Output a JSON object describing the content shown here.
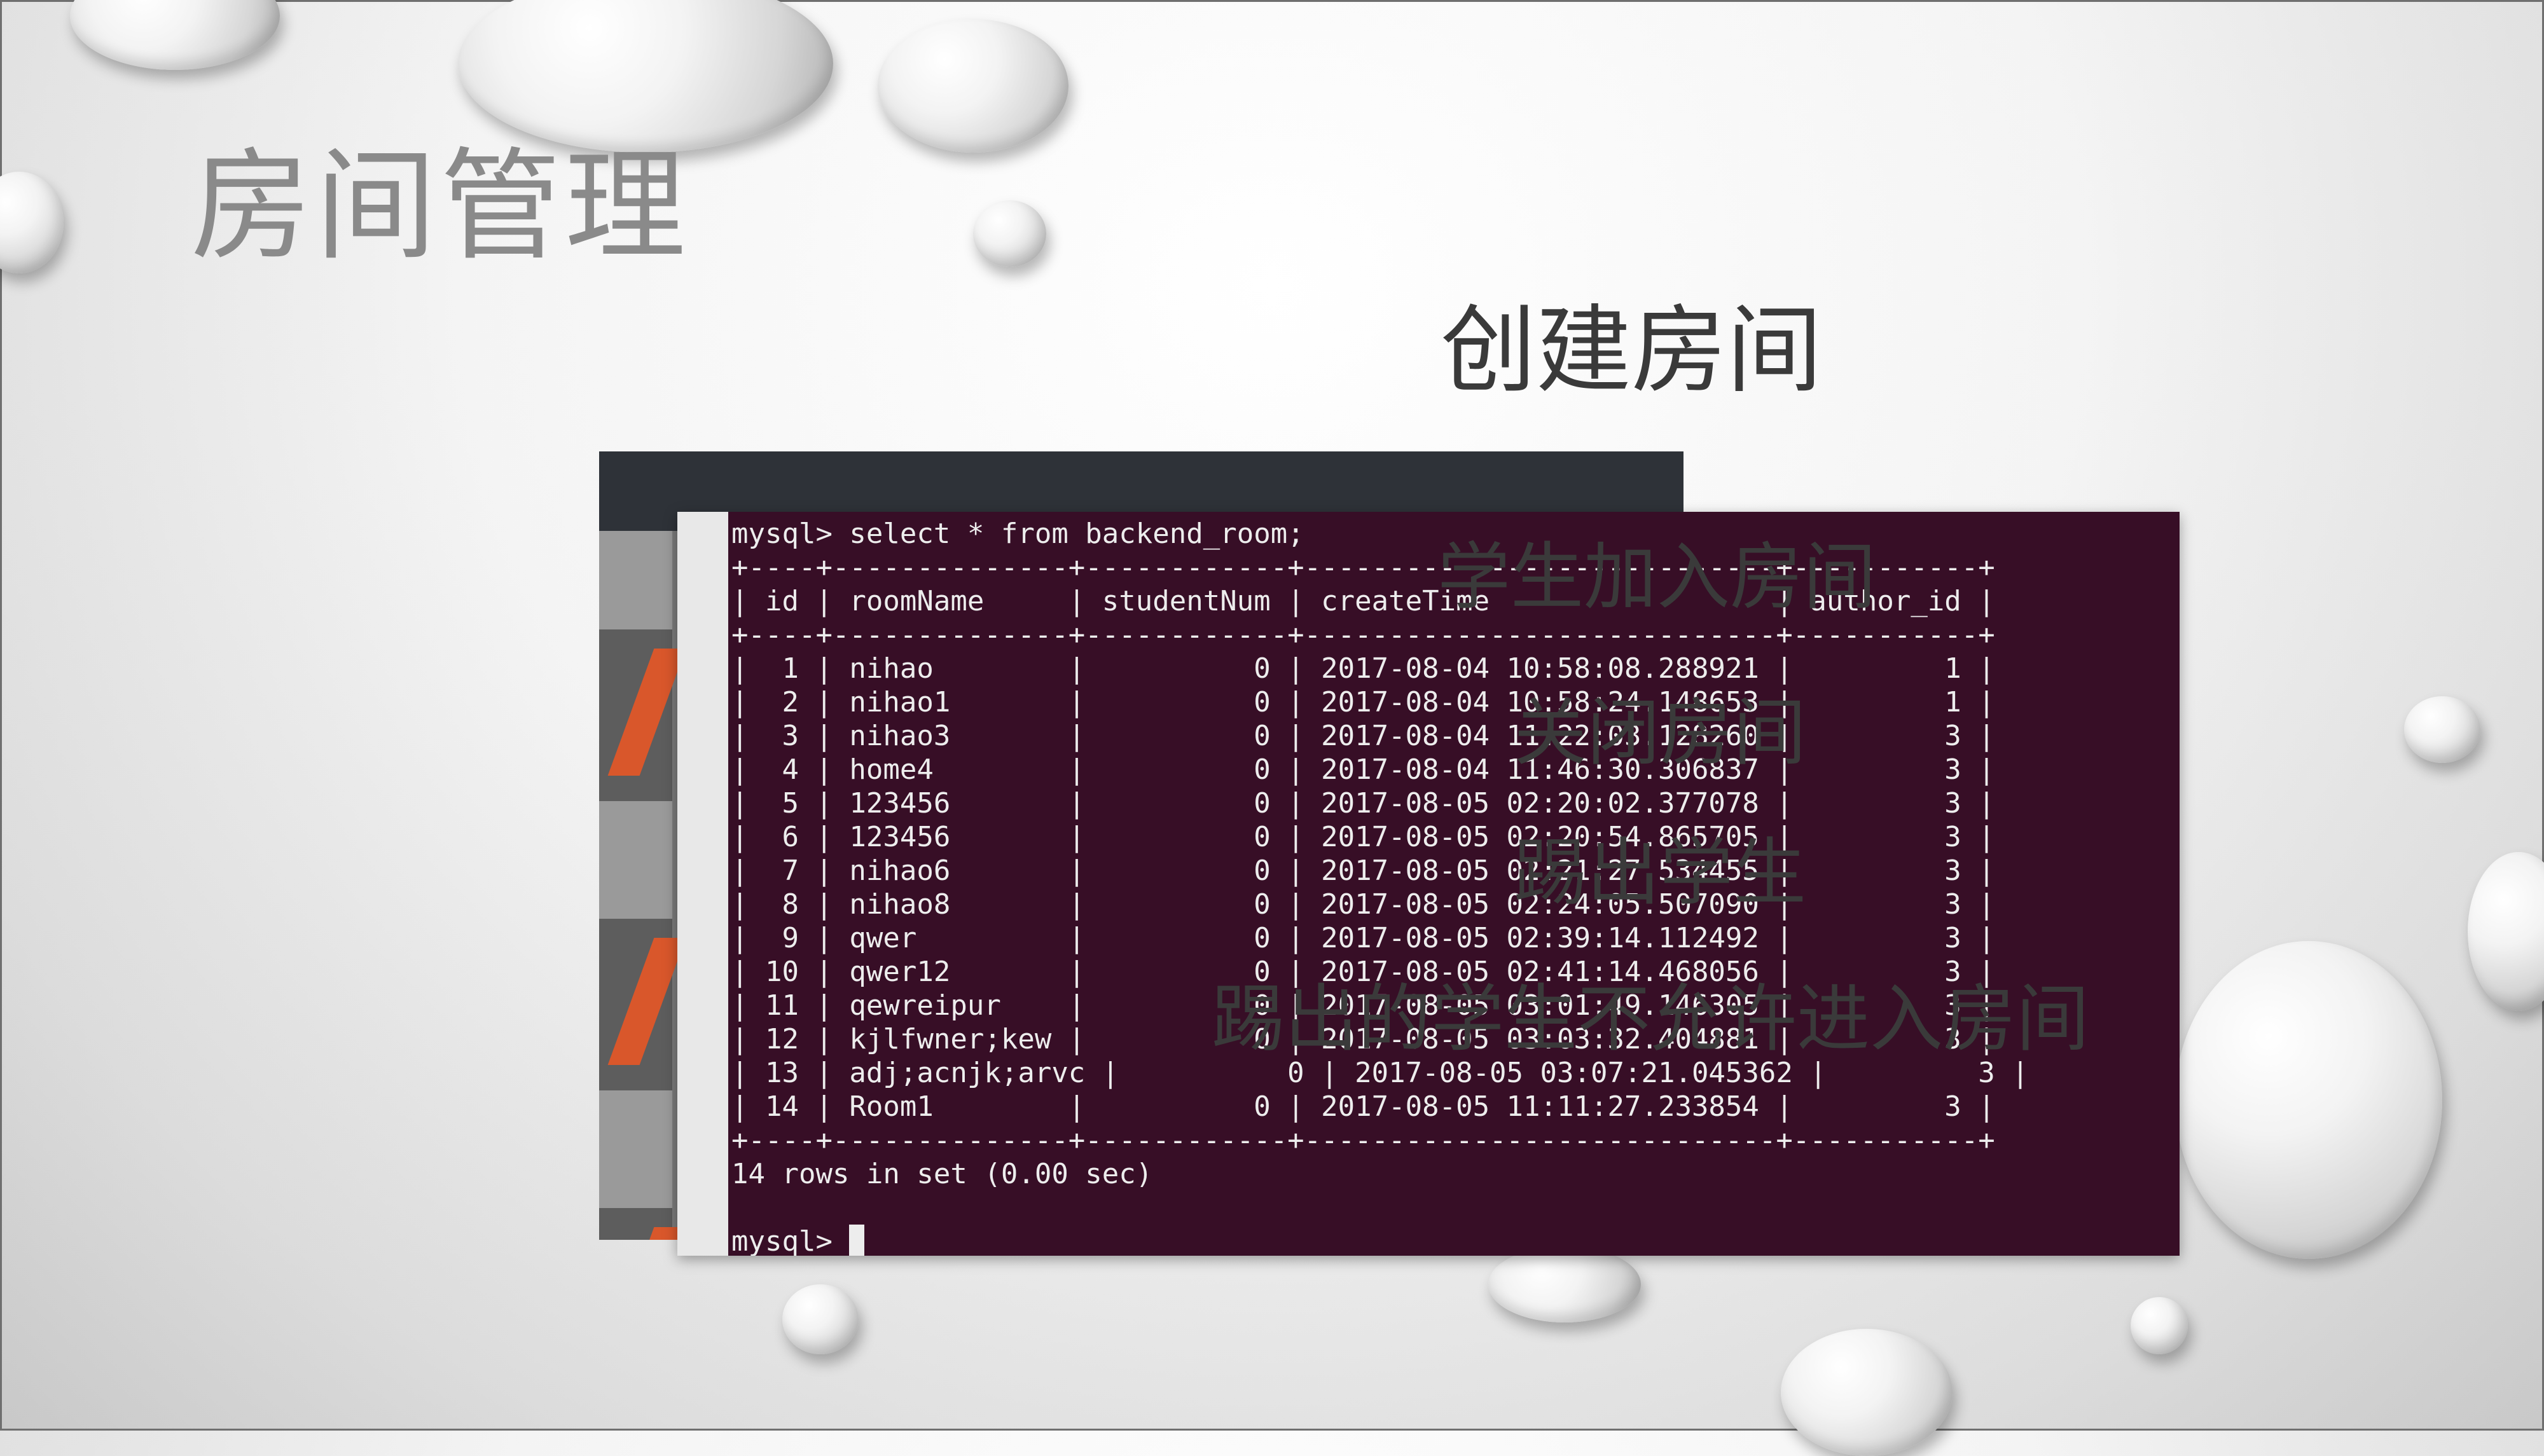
{
  "slide": {
    "title": "房间管理",
    "labels": {
      "create_room": "创建房间",
      "student_join": "学生加入房间",
      "close_room": "关闭房间",
      "kick_student": "踢出学生",
      "kicked_no_rejoin": "踢出的学生不允许进入房间"
    }
  },
  "terminal": {
    "command_line": "mysql> select * from backend_room;",
    "border": "+----+--------------+------------+----------------------------+-----------+",
    "header": "| id | roomName     | studentNum | createTime                 | author_id |",
    "columns": [
      "id",
      "roomName",
      "studentNum",
      "createTime",
      "author_id"
    ],
    "rows": [
      {
        "id": "1",
        "roomName": "nihao",
        "studentNum": "0",
        "createTime": "2017-08-04 10:58:08.288921",
        "author_id": "1",
        "text": "|  1 | nihao        |          0 | 2017-08-04 10:58:08.288921 |         1 |"
      },
      {
        "id": "2",
        "roomName": "nihao1",
        "studentNum": "0",
        "createTime": "2017-08-04 10:58:24.148653",
        "author_id": "1",
        "text": "|  2 | nihao1       |          0 | 2017-08-04 10:58:24.148653 |         1 |"
      },
      {
        "id": "3",
        "roomName": "nihao3",
        "studentNum": "0",
        "createTime": "2017-08-04 11:22:03.128260",
        "author_id": "3",
        "text": "|  3 | nihao3       |          0 | 2017-08-04 11:22:03.128260 |         3 |"
      },
      {
        "id": "4",
        "roomName": "home4",
        "studentNum": "0",
        "createTime": "2017-08-04 11:46:30.306837",
        "author_id": "3",
        "text": "|  4 | home4        |          0 | 2017-08-04 11:46:30.306837 |         3 |"
      },
      {
        "id": "5",
        "roomName": "123456",
        "studentNum": "0",
        "createTime": "2017-08-05 02:20:02.377078",
        "author_id": "3",
        "text": "|  5 | 123456       |          0 | 2017-08-05 02:20:02.377078 |         3 |"
      },
      {
        "id": "6",
        "roomName": "123456",
        "studentNum": "0",
        "createTime": "2017-08-05 02:20:54.865705",
        "author_id": "3",
        "text": "|  6 | 123456       |          0 | 2017-08-05 02:20:54.865705 |         3 |"
      },
      {
        "id": "7",
        "roomName": "nihao6",
        "studentNum": "0",
        "createTime": "2017-08-05 02:21:27.534455",
        "author_id": "3",
        "text": "|  7 | nihao6       |          0 | 2017-08-05 02:21:27.534455 |         3 |"
      },
      {
        "id": "8",
        "roomName": "nihao8",
        "studentNum": "0",
        "createTime": "2017-08-05 02:24:05.507090",
        "author_id": "3",
        "text": "|  8 | nihao8       |          0 | 2017-08-05 02:24:05.507090 |         3 |"
      },
      {
        "id": "9",
        "roomName": "qwer",
        "studentNum": "0",
        "createTime": "2017-08-05 02:39:14.112492",
        "author_id": "3",
        "text": "|  9 | qwer         |          0 | 2017-08-05 02:39:14.112492 |         3 |"
      },
      {
        "id": "10",
        "roomName": "qwer12",
        "studentNum": "0",
        "createTime": "2017-08-05 02:41:14.468056",
        "author_id": "3",
        "text": "| 10 | qwer12       |          0 | 2017-08-05 02:41:14.468056 |         3 |"
      },
      {
        "id": "11",
        "roomName": "qewreipur",
        "studentNum": "0",
        "createTime": "2017-08-05 03:01:49.146305",
        "author_id": "3",
        "text": "| 11 | qewreipur    |          0 | 2017-08-05 03:01:49.146305 |         3 |"
      },
      {
        "id": "12",
        "roomName": "kjlfwner;kew",
        "studentNum": "0",
        "createTime": "2017-08-05 03:03:32.404881",
        "author_id": "3",
        "text": "| 12 | kjlfwner;kew |          0 | 2017-08-05 03:03:32.404881 |         3 |"
      },
      {
        "id": "13",
        "roomName": "adj;acnjk;arvc",
        "studentNum": "0",
        "createTime": "2017-08-05 03:07:21.045362",
        "author_id": "3",
        "text": "| 13 | adj;acnjk;arvc |          0 | 2017-08-05 03:07:21.045362 |         3 |"
      },
      {
        "id": "14",
        "roomName": "Room1",
        "studentNum": "0",
        "createTime": "2017-08-05 11:11:27.233854",
        "author_id": "3",
        "text": "| 14 | Room1        |          0 | 2017-08-05 11:11:27.233854 |         3 |"
      }
    ],
    "summary": "14 rows in set (0.00 sec)",
    "prompt": "mysql> "
  },
  "colors": {
    "terminal_bg": "#370e26",
    "terminal_text": "#ededed",
    "title_gray": "#8a8a8a"
  },
  "icons": {
    "cursor": "block-cursor-icon"
  }
}
